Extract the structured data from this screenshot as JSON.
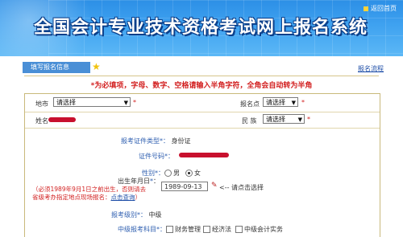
{
  "header": {
    "title": "全国会计专业技术资格考试网上报名系统",
    "home_link": "返回首页"
  },
  "tabs": {
    "active": "填写报名信息",
    "flow_link": "报名流程"
  },
  "notice": "*为必填项，字母、数字、空格请输入半角字符，全角会自动转为半角",
  "form": {
    "region_label": "地市",
    "region_value": "请选择",
    "region_req": "*",
    "site_label": "报名点",
    "site_value": "请选择",
    "site_req": "*",
    "name_label": "姓名",
    "ethnic_label": "民 族",
    "ethnic_value": "请选择",
    "ethnic_req": "*",
    "id_type_label": "报考证件类型",
    "id_type_star": "*",
    "id_type_value": "身份证",
    "id_no_label": "证件号码",
    "id_no_star": "*",
    "gender_label": "性别",
    "gender_star": "*",
    "gender_male": "男",
    "gender_female": "女",
    "dob_label": "出生年月日",
    "dob_star": "*",
    "dob_value": "1989-09-13",
    "dob_hint": "<-- 请点击选择",
    "dob_note_line1": "（必须1989年9月1日之前出生，否则请去",
    "dob_note_line2_pre": "省级考办指定地点现场报名：",
    "dob_note_link": "点击查询",
    "dob_note_line2_post": "）",
    "level_label": "报考级别",
    "level_star": "*",
    "level_value": "中级",
    "subjects_label": "中级报考科目",
    "subjects_star": "*",
    "subjects": [
      "财务管理",
      "经济法",
      "中级会计实务"
    ]
  },
  "colors": {
    "banner": "#2c8fe6",
    "accent_red": "#d21f1f",
    "tab": "#4a8fd6"
  }
}
